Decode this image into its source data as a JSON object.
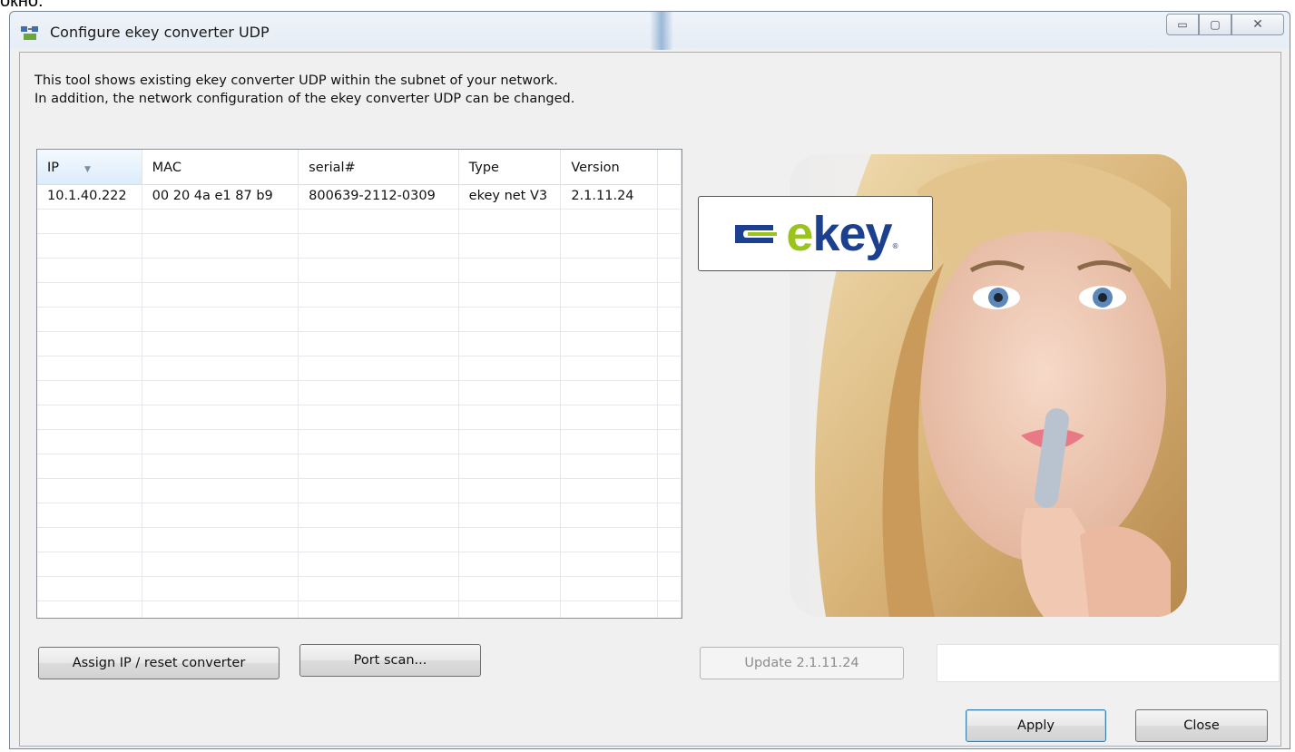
{
  "window": {
    "title": "Configure ekey converter UDP",
    "above_text": "окно:"
  },
  "caption_buttons": {
    "minimize": "▭",
    "maximize": "▢",
    "close": "✕"
  },
  "intro": {
    "line1": "This tool shows existing ekey converter UDP within the subnet of your network.",
    "line2": "In addition, the network configuration of the ekey converter UDP can be changed."
  },
  "table": {
    "columns": [
      "IP",
      "MAC",
      "serial#",
      "Type",
      "Version"
    ],
    "sorted_column": "IP",
    "rows": [
      {
        "ip": "10.1.40.222",
        "mac": "00 20 4a e1 87 b9",
        "serial": "800639-2112-0309",
        "type": "ekey net V3",
        "version": "2.1.11.24"
      }
    ]
  },
  "buttons": {
    "assign": "Assign IP / reset converter",
    "portscan": "Port scan...",
    "update": "Update 2.1.11.24",
    "apply": "Apply",
    "close": "Close"
  },
  "logo": {
    "text_e": "e",
    "text_rest": "key",
    "reg": "®"
  },
  "colors": {
    "logo_blue": "#1c3f8f",
    "logo_green": "#9ac31c",
    "accent": "#3c7fb1"
  }
}
